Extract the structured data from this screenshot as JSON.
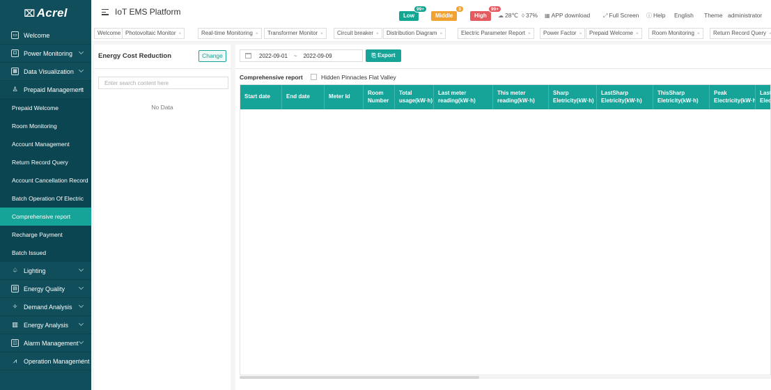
{
  "app": {
    "logo_mark": "⌧",
    "logo_text": "Acrel",
    "title": "IoT EMS Platform"
  },
  "alerts": {
    "low": {
      "label": "Low",
      "count": "99+",
      "color": "#13a693"
    },
    "middle": {
      "label": "Middle",
      "count": "3",
      "color": "#f0a233"
    },
    "high": {
      "label": "High",
      "count": "99+",
      "color": "#e35b5f"
    }
  },
  "header": {
    "temperature": "28℃",
    "humidity": "37%",
    "app_download": "APP download",
    "full_screen": "Full Screen",
    "help": "Help",
    "language": "English",
    "theme": "Theme",
    "user": "administrator"
  },
  "sidebar": {
    "items": [
      {
        "label": "Welcome",
        "icon": "monitor-icon",
        "glyph": "▭",
        "expand": false
      },
      {
        "label": "Power Monitoring",
        "icon": "power-monitor-icon",
        "glyph": "⊡",
        "expand": true
      },
      {
        "label": "Data Visualization",
        "icon": "data-visualization-icon",
        "glyph": "▦",
        "expand": true
      },
      {
        "label": "Prepaid Management",
        "icon": "prepaid-icon",
        "glyph": "♙",
        "expand": "up"
      }
    ],
    "sub_items": [
      {
        "label": "Prepaid Welcome",
        "active": false
      },
      {
        "label": "Room Monitoring",
        "active": false
      },
      {
        "label": "Account Management",
        "active": false
      },
      {
        "label": "Return Record Query",
        "active": false
      },
      {
        "label": "Account Cancellation Record",
        "active": false
      },
      {
        "label": "Batch Operation Of Electric",
        "active": false
      },
      {
        "label": "Comprehensive report",
        "active": true
      },
      {
        "label": "Recharge Payment",
        "active": false
      },
      {
        "label": "Batch Issued",
        "active": false
      }
    ],
    "bottom_items": [
      {
        "label": "Lighting",
        "icon": "lighting-icon",
        "glyph": "♤"
      },
      {
        "label": "Energy Quality",
        "icon": "energy-quality-icon",
        "glyph": "▤"
      },
      {
        "label": "Demand Analysis",
        "icon": "demand-analysis-icon",
        "glyph": "✧"
      },
      {
        "label": "Energy Analysis",
        "icon": "energy-analysis-icon",
        "glyph": "▥"
      },
      {
        "label": "Alarm Management",
        "icon": "alarm-icon",
        "glyph": "◫"
      },
      {
        "label": "Operation Management",
        "icon": "operation-icon",
        "glyph": "⩘"
      }
    ]
  },
  "tabs": [
    {
      "label": "Welcome",
      "closable": false
    },
    {
      "label": "Photovoltaic Monitor",
      "closable": true
    },
    {
      "label": "Real-time Monitoring",
      "closable": true
    },
    {
      "label": "Transformer Monitor",
      "closable": true
    },
    {
      "label": "Circuit breaker",
      "closable": true
    },
    {
      "label": "Distribution Diagram",
      "closable": true
    },
    {
      "label": "Electric Parameter Report",
      "closable": true
    },
    {
      "label": "Power Factor",
      "closable": true
    },
    {
      "label": "Prepaid Welcome",
      "closable": true
    },
    {
      "label": "Room Monitoring",
      "closable": true
    },
    {
      "label": "Return Record Query",
      "closable": true
    }
  ],
  "left_panel": {
    "title": "Energy Cost Reduction",
    "change_label": "Change",
    "search_placeholder": "Enter search content here",
    "empty_text": "No Data"
  },
  "report": {
    "date_start": "2022-09-01",
    "date_sep": "~",
    "date_end": "2022-09-09",
    "export_label": "Export",
    "title": "Comprehensive report",
    "hidden_label": "Hidden Pinnacles Flat Valley",
    "columns": [
      "Start date",
      "End date",
      "Meter Id",
      "Room Number",
      "Total usage(kW·h)",
      "Last meter reading(kW·h)",
      "This meter reading(kW·h)",
      "Sharp Eletricity(kW·h)",
      "LastSharp Eletricity(kW·h)",
      "ThisSharp Eletricity(kW·h)",
      "Peak Electricity(kW·h)",
      "LastPeak Electricity(kW·h)"
    ],
    "rows": []
  }
}
